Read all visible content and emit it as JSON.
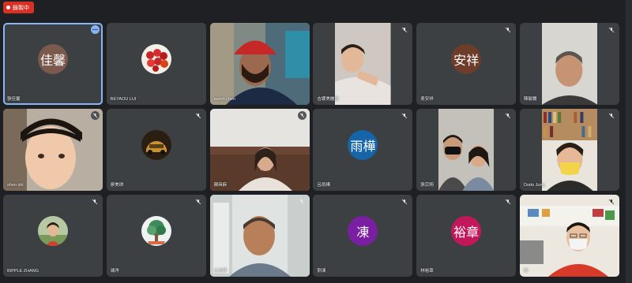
{
  "recording": {
    "label": "錄製中"
  },
  "participants": [
    {
      "name": "張佳馨",
      "initials": "佳馨",
      "color": "#7b5a4d",
      "kind": "letter",
      "active": true,
      "menu": true
    },
    {
      "name": "BEYAOU LUI",
      "kind": "photo",
      "photo": "fruit-avatar",
      "muted": false
    },
    {
      "name": "aaron chen",
      "kind": "video",
      "video": "man-red-cap"
    },
    {
      "name": "吉娜美麗說",
      "kind": "video",
      "video": "girl-leaning",
      "muted": true
    },
    {
      "name": "吳安祥",
      "initials": "安祥",
      "color": "#6d3d2a",
      "kind": "letter",
      "muted": true
    },
    {
      "name": "陳敏騰",
      "kind": "video",
      "video": "older-man",
      "muted": true
    },
    {
      "name": "shen shi",
      "kind": "video",
      "video": "child-closeup",
      "muted": true
    },
    {
      "name": "廖美琪",
      "kind": "photo",
      "photo": "car-avatar",
      "muted": true
    },
    {
      "name": "蘇麻麻",
      "kind": "video",
      "video": "woman-sofa",
      "muted": true
    },
    {
      "name": "呂雨樺",
      "initials": "雨樺",
      "color": "#1565a8",
      "kind": "letter",
      "muted": true
    },
    {
      "name": "張宗翔",
      "kind": "video",
      "video": "two-people",
      "muted": true
    },
    {
      "name": "Dodo Jung",
      "kind": "video",
      "video": "woman-mask-bookshelf",
      "muted": true
    },
    {
      "name": "BIPPLE ZHANG",
      "kind": "photo",
      "photo": "child-green-avatar",
      "muted": true
    },
    {
      "name": "瑀涔",
      "kind": "photo",
      "photo": "tree-avatar",
      "muted": true
    },
    {
      "name": "王金輝",
      "kind": "video",
      "video": "bald-man",
      "muted": true
    },
    {
      "name": "劉凍",
      "initials": "凍",
      "color": "#7b1fa2",
      "kind": "letter",
      "muted": true
    },
    {
      "name": "林裕章",
      "initials": "裕章",
      "color": "#c2185b",
      "kind": "letter",
      "muted": true
    },
    {
      "name": "你",
      "kind": "video",
      "video": "boy-mask-classroom",
      "muted": true
    }
  ],
  "icons": {
    "mic_off": "mic-off-icon",
    "more": "more-vert-icon"
  }
}
